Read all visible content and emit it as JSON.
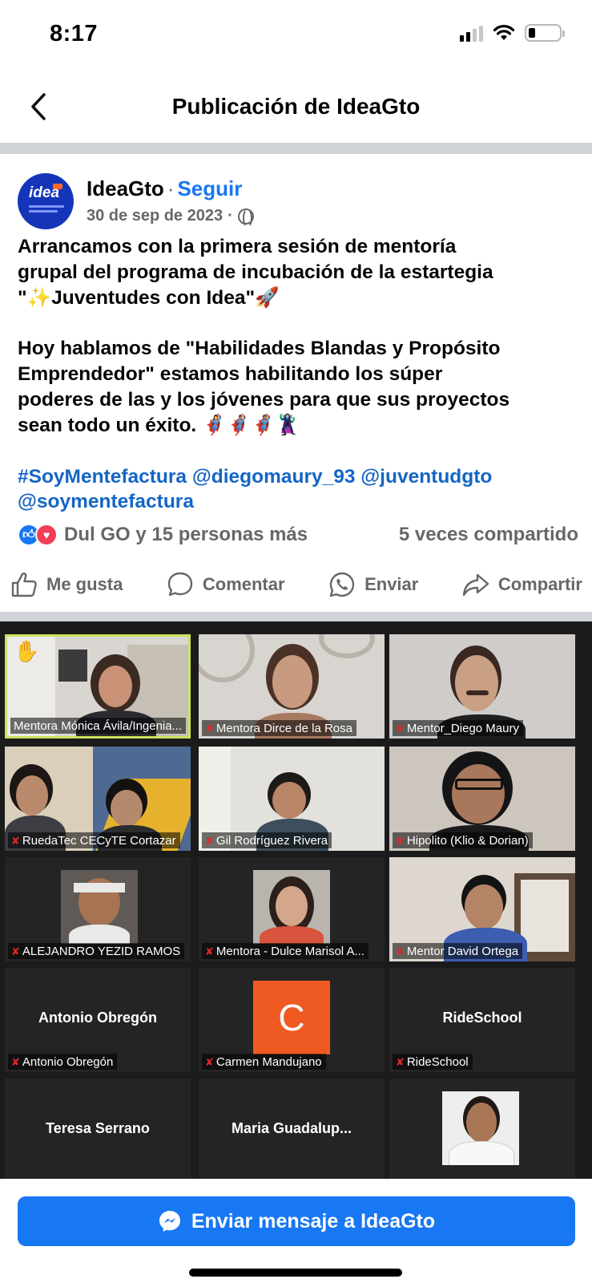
{
  "status": {
    "time": "8:17",
    "battery_level": 0.22
  },
  "header": {
    "title": "Publicación de IdeaGto"
  },
  "post": {
    "author": "IdeaGto",
    "separator": "·",
    "follow_label": "Seguir",
    "date": "30 de sep de 2023",
    "date_separator": "·",
    "avatar_text": "idea",
    "lines": [
      "Arrancamos con la primera sesión de mentoría",
      "grupal del programa de incubación de la estartegia",
      "\"✨Juventudes con Idea\"🚀",
      "Hoy hablamos de \"Habilidades Blandas y Propósito",
      "Emprendedor\" estamos habilitando los súper",
      "poderes de las y los jóvenes para que sus proyectos",
      "sean todo un éxito. 🦸‍♀️🦸🏽‍♂️🦸🏽🦹‍♀️"
    ],
    "tags_line1": "#SoyMentefactura @diegomaury_93 @juventudgto",
    "tags_line2": "@soymentefactura",
    "reactions_text": "Dul GO y 15 personas más",
    "shares_text": "5 veces compartido"
  },
  "actions": {
    "like": "Me gusta",
    "comment": "Comentar",
    "send": "Enviar",
    "share": "Compartir"
  },
  "zoom": {
    "tiles": [
      "Mentora Mónica Ávila/Ingenia...",
      "Mentora Dirce de la Rosa",
      "Mentor_Diego Maury",
      "RuedaTec CECyTE Cortazar",
      "Gil Rodríguez Rivera",
      "Hipolito (Klio & Dorian)",
      "ALEJANDRO YEZID RAMOS",
      "Mentora - Dulce Marisol A...",
      "Mentor David Ortega",
      "Antonio Obregón",
      "Carmen Mandujano",
      "RideSchool"
    ],
    "center_names": {
      "antonio": "Antonio Obregón",
      "rideschool": "RideSchool",
      "teresa": "Teresa Serrano",
      "maria": "Maria  Guadalup..."
    },
    "carmen_initial": "C",
    "hand_emoji": "✋"
  },
  "cta": {
    "label": "Enviar mensaje a IdeaGto"
  },
  "colors": {
    "brand_blue": "#1877f2",
    "link_blue": "#1465c6",
    "divider": "#cfd2d6"
  }
}
